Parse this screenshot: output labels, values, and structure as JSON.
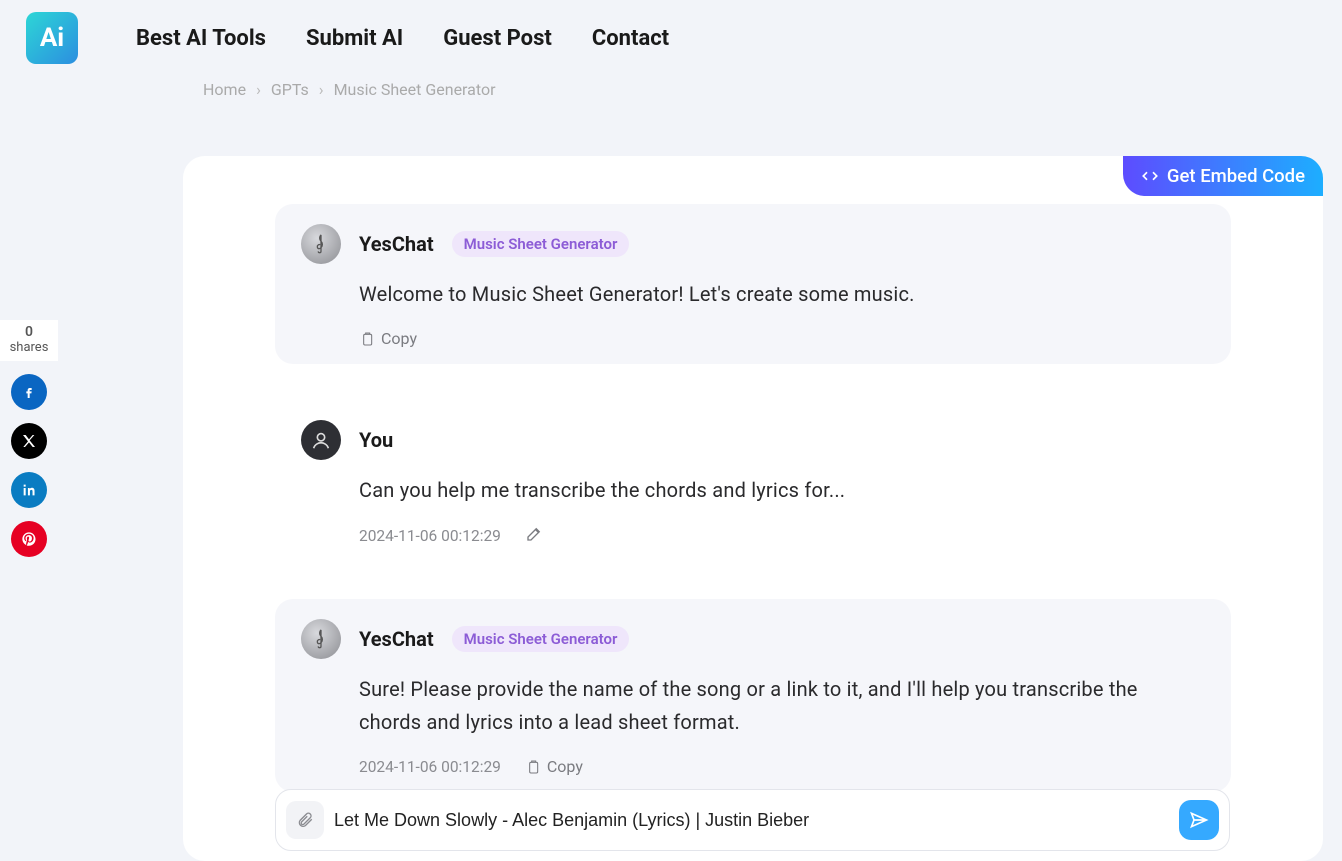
{
  "nav": {
    "items": [
      "Best AI Tools",
      "Submit AI",
      "Guest Post",
      "Contact"
    ]
  },
  "breadcrumb": {
    "items": [
      "Home",
      "GPTs",
      "Music Sheet Generator"
    ]
  },
  "embed": {
    "label": "Get Embed Code"
  },
  "shares": {
    "count": "0",
    "label": "shares"
  },
  "badge": "Music Sheet Generator",
  "copy_label": "Copy",
  "messages": [
    {
      "sender": "YesChat",
      "role": "bot",
      "text": "Welcome to Music Sheet Generator! Let's create some music.",
      "timestamp": "",
      "has_copy": true,
      "has_edit": false,
      "has_badge": true
    },
    {
      "sender": "You",
      "role": "user",
      "text": "Can you help me transcribe the chords and lyrics for...",
      "timestamp": "2024-11-06 00:12:29",
      "has_copy": false,
      "has_edit": true,
      "has_badge": false
    },
    {
      "sender": "YesChat",
      "role": "bot",
      "text": "Sure! Please provide the name of the song or a link to it, and I'll help you transcribe the chords and lyrics into a lead sheet format.",
      "timestamp": "2024-11-06 00:12:29",
      "has_copy": true,
      "has_edit": false,
      "has_badge": true
    }
  ],
  "input": {
    "value": "Let Me Down Slowly - Alec Benjamin (Lyrics) | Justin Bieber"
  }
}
